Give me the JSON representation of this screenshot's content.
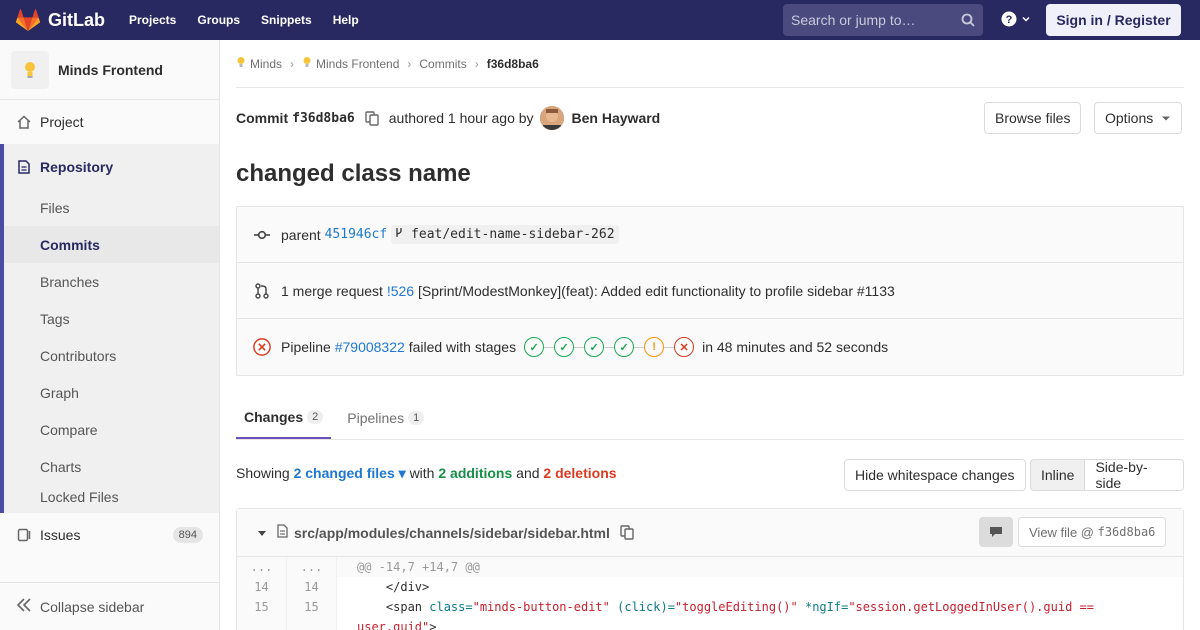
{
  "nav": {
    "brand": "GitLab",
    "links": [
      "Projects",
      "Groups",
      "Snippets",
      "Help"
    ],
    "search_placeholder": "Search or jump to…",
    "help_icon": "question-icon",
    "signin": "Sign in / Register",
    "colors": {
      "bar": "#292961",
      "logo": "#fc6d26"
    }
  },
  "sidebar": {
    "project_name": "Minds Frontend",
    "project": "Project",
    "repository": "Repository",
    "repo_items": [
      "Files",
      "Commits",
      "Branches",
      "Tags",
      "Contributors",
      "Graph",
      "Compare",
      "Charts",
      "Locked Files"
    ],
    "active_item": "Commits",
    "issues": "Issues",
    "issues_count": "894",
    "collapse": "Collapse sidebar"
  },
  "breadcrumb": [
    "Minds",
    "Minds Frontend",
    "Commits",
    "f36d8ba6"
  ],
  "commit": {
    "label": "Commit",
    "sha": "f36d8ba6",
    "authored": "authored 1 hour ago by",
    "author": "Ben Hayward",
    "browse": "Browse files",
    "options": "Options",
    "title": "changed class name"
  },
  "info": {
    "parent_label": "parent",
    "parent_sha": "451946cf",
    "branch": "feat/edit-name-sidebar-262",
    "mr_label": "1 merge request",
    "mr_id": "!526",
    "mr_title": "[Sprint/ModestMonkey](feat): Added edit functionality to profile sidebar #1133",
    "pipeline_label": "Pipeline",
    "pipeline_id": "#79008322",
    "pipeline_status": "failed with stages",
    "stages": [
      "success",
      "success",
      "success",
      "success",
      "warning",
      "failed"
    ],
    "duration": "in 48 minutes and 52 seconds"
  },
  "tabs": [
    {
      "label": "Changes",
      "count": "2"
    },
    {
      "label": "Pipelines",
      "count": "1"
    }
  ],
  "summary": {
    "showing": "Showing",
    "changed": "2 changed files",
    "with": "with",
    "additions": "2 additions",
    "and": "and",
    "deletions": "2 deletions",
    "hide_ws": "Hide whitespace changes",
    "inline": "Inline",
    "side": "Side-by-side"
  },
  "file": {
    "path": "src/app/modules/channels/sidebar/sidebar.html",
    "view_file": "View file @",
    "view_sha": "f36d8ba6"
  },
  "diff": {
    "hunk_ln": "...",
    "hunk": "@@ -14,7 +14,7 @@",
    "lines": [
      {
        "old": "14",
        "new": "14",
        "code": "    </div>"
      },
      {
        "old": "15",
        "new": "15",
        "tag_open": "    <span ",
        "a1": "class=",
        "v1": "\"minds-button-edit\"",
        "a2": " (click)=",
        "v2": "\"toggleEditing()\"",
        "a3": " *ngIf=",
        "v3": "\"session.getLoggedInUser().guid ==",
        "wrap": "user.guid\"",
        "tag_close": ">"
      }
    ]
  }
}
